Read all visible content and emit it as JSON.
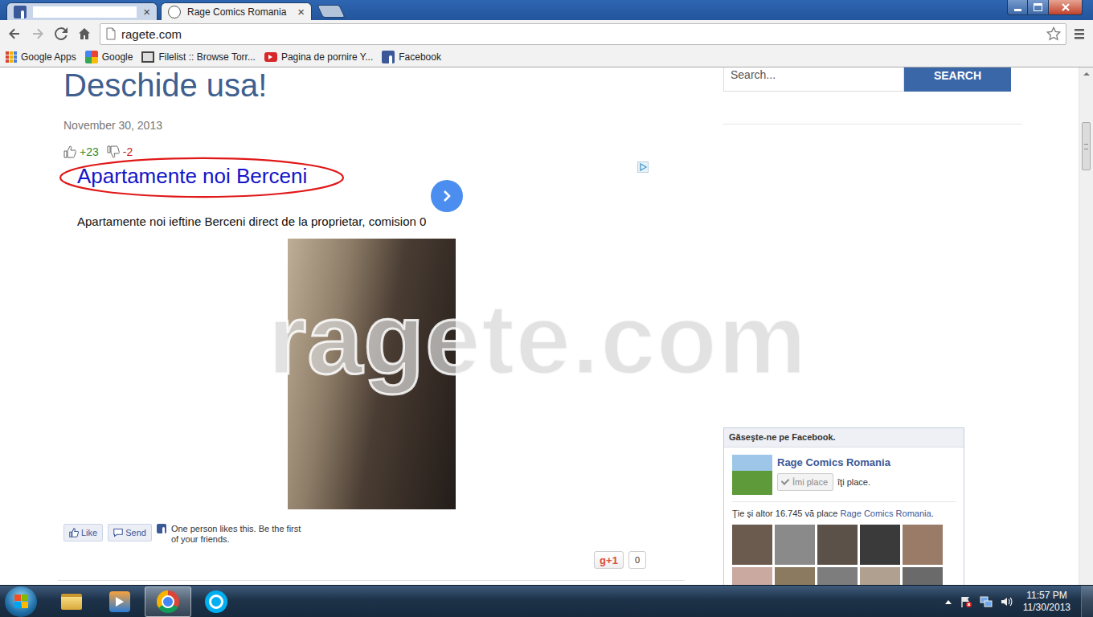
{
  "tabs": [
    {
      "kind": "redacted",
      "label": "",
      "selected": false,
      "close": "×"
    },
    {
      "kind": "titled",
      "label": "Rage Comics Romania",
      "selected": true,
      "close": "×"
    }
  ],
  "address": {
    "url": "ragete.com"
  },
  "bookmarks": [
    {
      "kind": "apps",
      "label": "Google Apps"
    },
    {
      "kind": "google",
      "label": "Google"
    },
    {
      "kind": "filelist",
      "label": "Filelist :: Browse Torr..."
    },
    {
      "kind": "youtube",
      "label": "Pagina de pornire Y..."
    },
    {
      "kind": "facebook",
      "label": "Facebook"
    }
  ],
  "post": {
    "title": "Deschide usa!",
    "date": "November 30, 2013",
    "votes": {
      "up": "+23",
      "down": "-2"
    }
  },
  "ad": {
    "title": "Apartamente noi Berceni",
    "text": "Apartamente noi ieftine Berceni direct de la proprietar, comision 0"
  },
  "watermark": "ragete.com",
  "social": {
    "like": "Like",
    "send": "Send",
    "note": "One person likes this. Be the first of your friends.",
    "gplus": "g+1",
    "gplus_count": "0"
  },
  "sidebar": {
    "search": {
      "placeholder": "Search...",
      "button": "SEARCH"
    },
    "facebook": {
      "header": "Găseşte-ne pe Facebook.",
      "page": "Rage Comics Romania",
      "like_button": "Îmi place",
      "like_suffix": "îţi place.",
      "fans_prefix": "Ţie şi altor 16.745 vă place ",
      "fans_link": "Rage Comics Romania",
      "fans_suffix": "."
    }
  },
  "taskbar": {
    "apps": [
      {
        "kind": "explorer",
        "active": false
      },
      {
        "kind": "media",
        "active": false
      },
      {
        "kind": "chrome",
        "active": true
      },
      {
        "kind": "skype",
        "active": false
      }
    ],
    "clock": {
      "time": "11:57 PM",
      "date": "11/30/2013"
    }
  }
}
